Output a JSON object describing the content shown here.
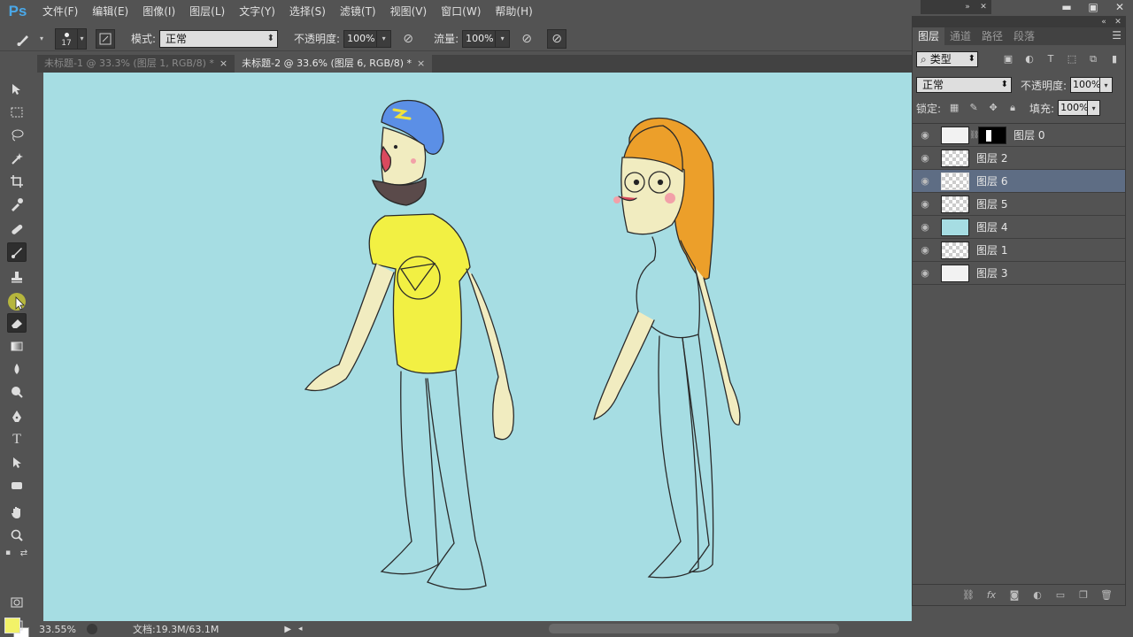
{
  "app": {
    "logo": "Ps"
  },
  "menu": [
    "文件(F)",
    "编辑(E)",
    "图像(I)",
    "图层(L)",
    "文字(Y)",
    "选择(S)",
    "滤镜(T)",
    "视图(V)",
    "窗口(W)",
    "帮助(H)"
  ],
  "window_controls": {
    "minimize": "▬",
    "restore": "▣",
    "close": "✕"
  },
  "options": {
    "brush_size": "17",
    "mode_label": "模式:",
    "mode_value": "正常",
    "opacity_label": "不透明度:",
    "opacity_value": "100%",
    "flow_label": "流量:",
    "flow_value": "100%"
  },
  "tabs": [
    {
      "label": "未标题-1 @ 33.3% (图层 1, RGB/8) *",
      "close": "×"
    },
    {
      "label": "未标题-2 @ 33.6% (图层 6, RGB/8) *",
      "close": "×"
    }
  ],
  "colors": {
    "foreground": "#f2f268",
    "background": "#ffffff",
    "canvas": "#a6dde3",
    "selected_layer": "#5e6d84"
  },
  "status": {
    "zoom": "33.55%",
    "doc_info": "文档:19.3M/63.1M"
  },
  "layers_panel": {
    "tabs": [
      "图层",
      "通道",
      "路径",
      "段落"
    ],
    "filter_value": "类型",
    "blend_value": "正常",
    "opacity_label": "不透明度:",
    "opacity_value": "100%",
    "lock_label": "锁定:",
    "fill_label": "填充:",
    "fill_value": "100%",
    "layers": [
      {
        "name": "图层 0",
        "thumb": "white",
        "mask": true,
        "selected": false
      },
      {
        "name": "图层 2",
        "thumb": "checker",
        "mask": false,
        "selected": false
      },
      {
        "name": "图层 6",
        "thumb": "checker",
        "mask": false,
        "selected": true
      },
      {
        "name": "图层 5",
        "thumb": "checker",
        "mask": false,
        "selected": false
      },
      {
        "name": "图层 4",
        "thumb": "cyan",
        "mask": false,
        "selected": false
      },
      {
        "name": "图层 1",
        "thumb": "checker",
        "mask": false,
        "selected": false
      },
      {
        "name": "图层 3",
        "thumb": "white",
        "mask": false,
        "selected": false
      }
    ]
  }
}
